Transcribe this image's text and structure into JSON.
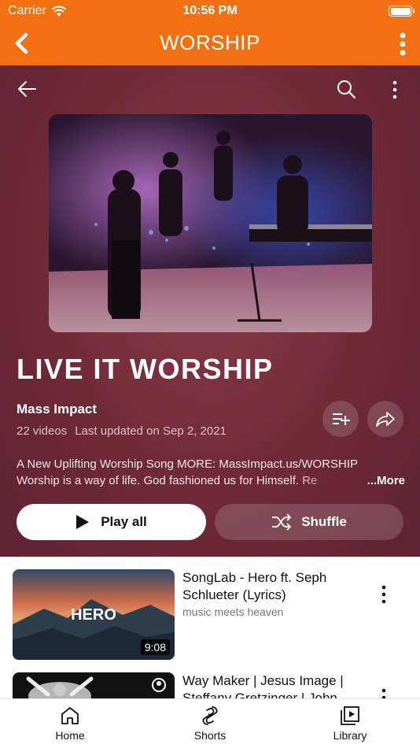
{
  "status_bar": {
    "carrier": "Carrier",
    "time": "10:56 PM"
  },
  "app_header": {
    "title": "WORSHIP"
  },
  "playlist": {
    "title": "LIVE IT WORSHIP",
    "channel": "Mass Impact",
    "video_count": "22 videos",
    "last_updated": "Last updated on Sep 2, 2021",
    "description_line1": "A New Uplifting Worship Song MORE: MassImpact.us/WORSHIP",
    "description_line2": "Worship is a way of life. God fashioned us for Himself. Re",
    "more_label": "...More",
    "play_all_label": "Play all",
    "shuffle_label": "Shuffle"
  },
  "videos": [
    {
      "title": "SongLab - Hero ft. Seph Schlueter (Lyrics)",
      "channel": "music meets heaven",
      "duration": "9:08",
      "thumb_text": "HERO"
    },
    {
      "title": "Way Maker | Jesus Image | Steffany Gretzinger | John"
    }
  ],
  "tabs": [
    {
      "label": "Home",
      "icon": "home-icon"
    },
    {
      "label": "Shorts",
      "icon": "shorts-icon"
    },
    {
      "label": "Library",
      "icon": "library-icon"
    }
  ],
  "colors": {
    "accent": "#f27011",
    "hero_bg": "#6f2a36"
  }
}
